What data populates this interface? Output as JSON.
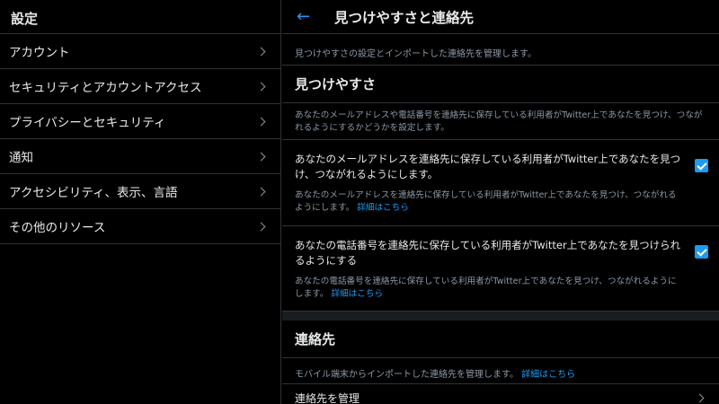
{
  "sidebar": {
    "title": "設定",
    "items": [
      {
        "label": "アカウント"
      },
      {
        "label": "セキュリティとアカウントアクセス"
      },
      {
        "label": "プライバシーとセキュリティ"
      },
      {
        "label": "通知"
      },
      {
        "label": "アクセシビリティ、表示、言語"
      },
      {
        "label": "その他のリソース"
      }
    ]
  },
  "main": {
    "back_icon": "←",
    "title": "見つけやすさと連絡先",
    "description": "見つけやすさの設定とインポートした連絡先を管理します。",
    "discoverability": {
      "heading": "見つけやすさ",
      "description": "あなたのメールアドレスや電話番号を連絡先に保存している利用者がTwitter上であなたを見つけ、つながれるようにするかどうかを設定します。",
      "options": [
        {
          "label": "あなたのメールアドレスを連絡先に保存している利用者がTwitter上であなたを見つけ、つながれるようにします。",
          "sub": "あなたのメールアドレスを連絡先に保存している利用者がTwitter上であなたを見つけ、つながれるようにします。",
          "link": "詳細はこちら",
          "checked": true
        },
        {
          "label": "あなたの電話番号を連絡先に保存している利用者がTwitter上であなたを見つけられるようにする",
          "sub": "あなたの電話番号を連絡先に保存している利用者がTwitter上であなたを見つけ、つながれるようにします。",
          "link": "詳細はこちら",
          "checked": true
        }
      ]
    },
    "contacts": {
      "heading": "連絡先",
      "description": "モバイル端末からインポートした連絡先を管理します。",
      "link": "詳細はこちら",
      "manage_label": "連絡先を管理"
    }
  },
  "colors": {
    "accent": "#1d9bf0",
    "background": "#000000",
    "border": "#2f3336",
    "muted_text": "#8b98a5"
  }
}
